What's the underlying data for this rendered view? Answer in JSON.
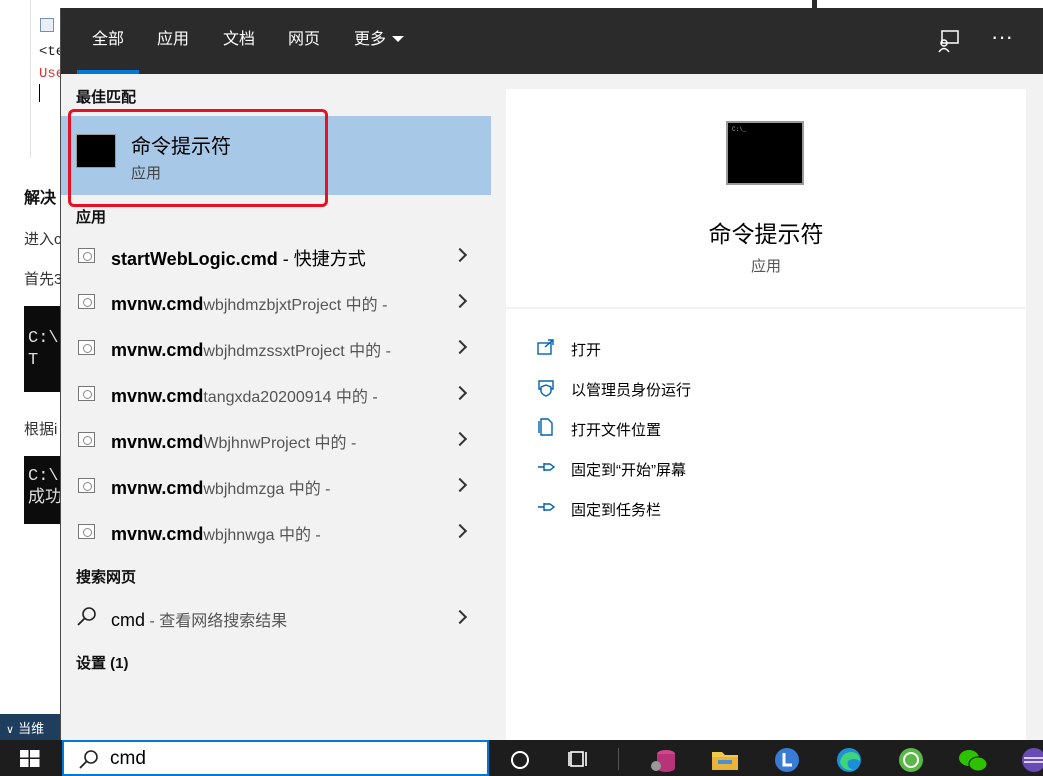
{
  "background": {
    "code_line_1": "<te",
    "code_line_2": "Use",
    "text_1": "解决",
    "text_2": "进入c",
    "text_3": "首先3",
    "term_1_line_1": "C:\\",
    "term_1_line_2": " T",
    "text_4": "根据i",
    "term_2_line_1": "C:\\",
    "term_2_line_2": "成功",
    "status_text": "当维"
  },
  "tabs": [
    {
      "label": "全部",
      "active": true
    },
    {
      "label": "应用"
    },
    {
      "label": "文档"
    },
    {
      "label": "网页"
    },
    {
      "label": "更多"
    }
  ],
  "topbar_icons": {
    "feedback": "feedback-icon",
    "more": "more-icon",
    "more_glyph": "···"
  },
  "best_match": {
    "heading": "最佳匹配",
    "title": "命令提示符",
    "subtitle": "应用",
    "icon": "cmd-app-icon"
  },
  "apps": {
    "heading": "应用",
    "items": [
      {
        "bold": "startWebLogic.cmd",
        "normal": " - 快捷方式",
        "dim": ""
      },
      {
        "bold": "mvnw.cmd",
        "normal": "",
        "dim": "wbjhdmzbjxtProject 中的 -"
      },
      {
        "bold": "mvnw.cmd",
        "normal": "",
        "dim": "wbjhdmzssxtProject 中的 -"
      },
      {
        "bold": "mvnw.cmd",
        "normal": "",
        "dim": "tangxda20200914 中的 -"
      },
      {
        "bold": "mvnw.cmd",
        "normal": "",
        "dim": "WbjhnwProject 中的 -"
      },
      {
        "bold": "mvnw.cmd",
        "normal": "",
        "dim": "wbjhdmzga 中的 -"
      },
      {
        "bold": "mvnw.cmd",
        "normal": "",
        "dim": "wbjhnwga 中的 -"
      }
    ]
  },
  "web_search": {
    "heading": "搜索网页",
    "query": "cmd",
    "suffix": " - 查看网络搜索结果"
  },
  "settings": {
    "heading": "设置 (1)"
  },
  "detail": {
    "title": "命令提示符",
    "subtitle": "应用",
    "icon_text": "C:\\_",
    "actions": [
      {
        "label": "打开",
        "icon": "open-icon"
      },
      {
        "label": "以管理员身份运行",
        "icon": "run-as-admin-icon"
      },
      {
        "label": "打开文件位置",
        "icon": "file-location-icon"
      },
      {
        "label": "固定到“开始”屏幕",
        "icon": "pin-icon"
      },
      {
        "label": "固定到任务栏",
        "icon": "pin-icon"
      }
    ]
  },
  "taskbar": {
    "search_value": "cmd",
    "colors": {
      "accent": "#0078d7",
      "highlight": "#a7c8e6",
      "red": "#e81123"
    }
  }
}
